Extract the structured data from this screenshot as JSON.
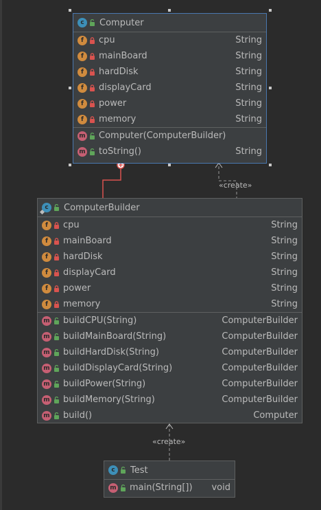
{
  "classes": {
    "computer": {
      "name": "Computer",
      "icon": "class-icon",
      "fields": [
        {
          "name": "cpu",
          "type": "String"
        },
        {
          "name": "mainBoard",
          "type": "String"
        },
        {
          "name": "hardDisk",
          "type": "String"
        },
        {
          "name": "displayCard",
          "type": "String"
        },
        {
          "name": "power",
          "type": "String"
        },
        {
          "name": "memory",
          "type": "String"
        }
      ],
      "methods": [
        {
          "name": "Computer(ComputerBuilder)",
          "type": ""
        },
        {
          "name": "toString()",
          "type": "String"
        }
      ]
    },
    "builder": {
      "name": "ComputerBuilder",
      "icon": "class-icon",
      "fields": [
        {
          "name": "cpu",
          "type": "String"
        },
        {
          "name": "mainBoard",
          "type": "String"
        },
        {
          "name": "hardDisk",
          "type": "String"
        },
        {
          "name": "displayCard",
          "type": "String"
        },
        {
          "name": "power",
          "type": "String"
        },
        {
          "name": "memory",
          "type": "String"
        }
      ],
      "methods": [
        {
          "name": "buildCPU(String)",
          "type": "ComputerBuilder"
        },
        {
          "name": "buildMainBoard(String)",
          "type": "ComputerBuilder"
        },
        {
          "name": "buildHardDisk(String)",
          "type": "ComputerBuilder"
        },
        {
          "name": "buildDisplayCard(String)",
          "type": "ComputerBuilder"
        },
        {
          "name": "buildPower(String)",
          "type": "ComputerBuilder"
        },
        {
          "name": "buildMemory(String)",
          "type": "ComputerBuilder"
        },
        {
          "name": "build()",
          "type": "Computer"
        }
      ]
    },
    "test": {
      "name": "Test",
      "icon": "class-icon",
      "fields": [],
      "methods": [
        {
          "name": "main(String[])",
          "type": "void"
        }
      ]
    }
  },
  "relations": {
    "create_label_1": "«create»",
    "create_label_2": "«create»"
  },
  "colors": {
    "background": "#2b2b2b",
    "box": "#3c3f41",
    "border": "#5e6060",
    "selection": "#4a78b0",
    "field_icon": "#d08b3e",
    "method_icon": "#c65f73",
    "class_icon": "#3d8fb8",
    "inner_class_link": "#d9534f"
  }
}
